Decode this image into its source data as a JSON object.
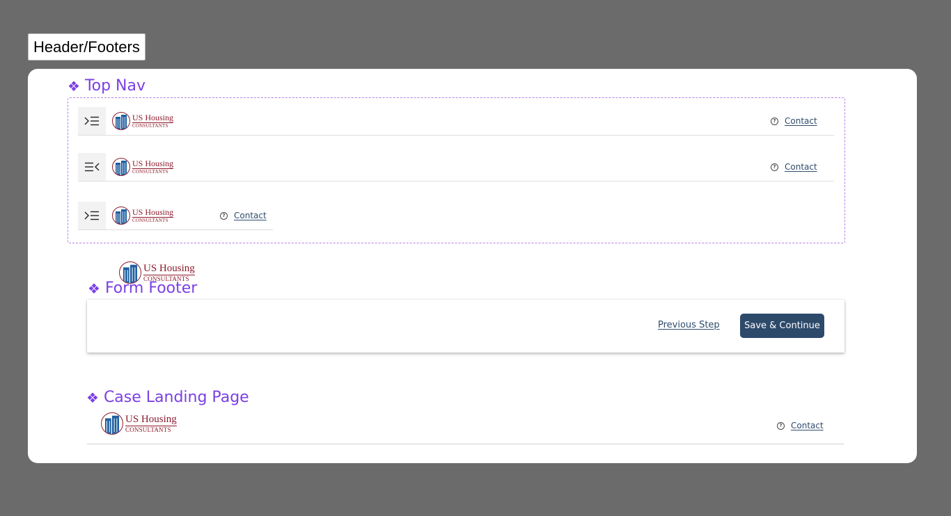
{
  "page_label": "Header/Footers",
  "colors": {
    "accent": "#7b3fe4",
    "brand_primary": "#2d4a6b",
    "logo_red": "#8b1a2b",
    "logo_blue": "#1f5fa0"
  },
  "logo": {
    "line1": "US Housing",
    "line2": "CONSULTANTS",
    "icon": "building-icon"
  },
  "sections": {
    "top_nav": {
      "title": "Top Nav",
      "symbol": "❖"
    },
    "form_footer": {
      "title": "Form Footer",
      "symbol": "❖"
    },
    "case_landing": {
      "title": "Case Landing Page",
      "symbol": "❖"
    }
  },
  "top_nav_variants": [
    {
      "menu_icon": "menu-expand-icon",
      "contact": "Contact"
    },
    {
      "menu_icon": "menu-collapse-icon",
      "contact": "Contact"
    },
    {
      "menu_icon": "menu-expand-icon",
      "contact": "Contact"
    }
  ],
  "form_footer": {
    "previous_label": "Previous Step",
    "save_label": "Save & Continue"
  },
  "case_landing": {
    "contact": "Contact"
  },
  "help_icon": "?"
}
